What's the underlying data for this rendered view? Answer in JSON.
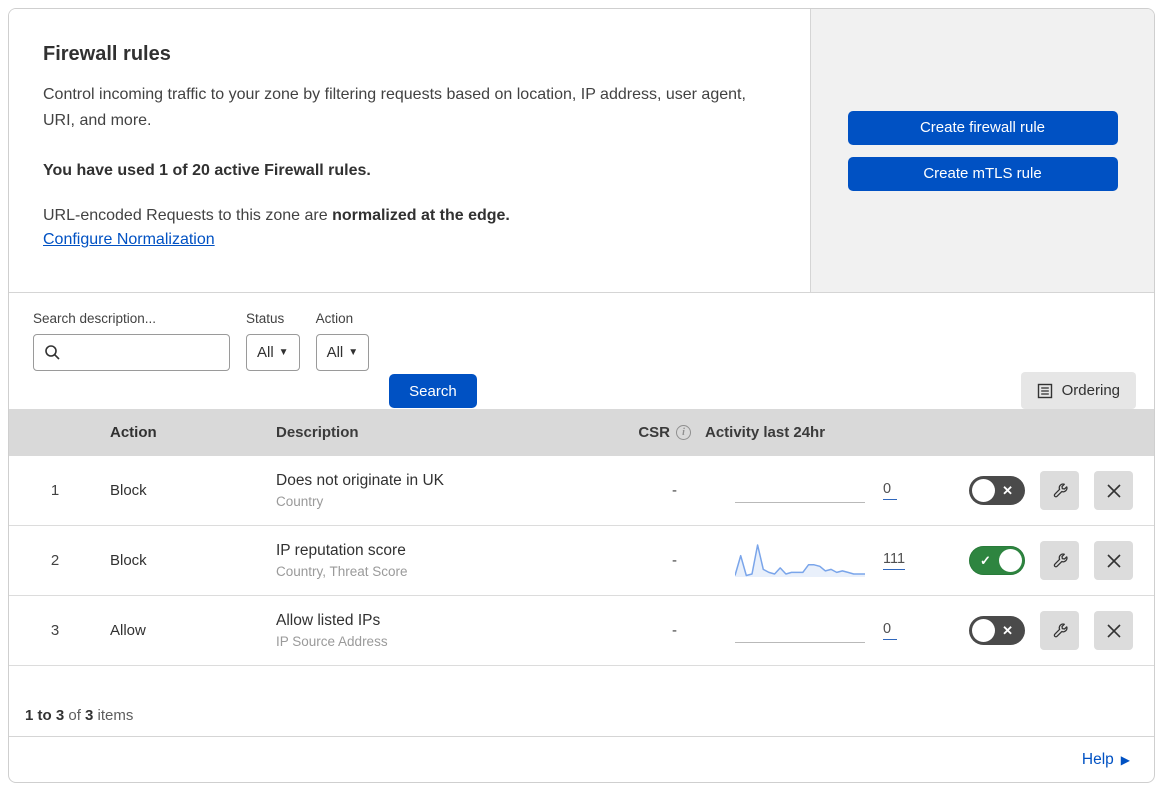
{
  "header": {
    "title": "Firewall rules",
    "description": "Control incoming traffic to your zone by filtering requests based on location, IP address, user agent, URI, and more.",
    "usage_notice": "You have used 1 of 20 active Firewall rules.",
    "normalization_prefix": "URL-encoded Requests to this zone are ",
    "normalization_bold": "normalized at the edge.",
    "normalization_link": "Configure Normalization",
    "create_firewall_rule_label": "Create firewall rule",
    "create_mtls_rule_label": "Create mTLS rule"
  },
  "filters": {
    "search_label": "Search description...",
    "search_value": "",
    "search_icon": "magnifier-icon",
    "status_label": "Status",
    "status_value": "All",
    "action_label": "Action",
    "action_value": "All",
    "search_button_label": "Search",
    "ordering_button_label": "Ordering",
    "ordering_icon": "list-document-icon"
  },
  "table": {
    "columns": {
      "action": "Action",
      "description": "Description",
      "csr": "CSR",
      "activity": "Activity last 24hr"
    },
    "csr_info_icon": "info-icon",
    "rows": [
      {
        "index": "1",
        "action": "Block",
        "description": "Does not originate in UK",
        "fields": "Country",
        "csr": "-",
        "activity_count": "0",
        "enabled": false,
        "has_sparkline": false
      },
      {
        "index": "2",
        "action": "Block",
        "description": "IP reputation score",
        "fields": "Country, Threat Score",
        "csr": "-",
        "activity_count": "111",
        "enabled": true,
        "has_sparkline": true
      },
      {
        "index": "3",
        "action": "Allow",
        "description": "Allow listed IPs",
        "fields": "IP Source Address",
        "csr": "-",
        "activity_count": "0",
        "enabled": false,
        "has_sparkline": false
      }
    ],
    "row_icons": {
      "toggle": "status-toggle",
      "edit": "wrench-icon",
      "delete": "x-icon"
    }
  },
  "chart_data": {
    "type": "area",
    "title": "Activity last 24hr sparkline (rule 2: IP reputation score)",
    "x": [
      0,
      1,
      2,
      3,
      4,
      5,
      6,
      7,
      8,
      9,
      10,
      11,
      12,
      13,
      14,
      15,
      16,
      17,
      18,
      19,
      20,
      21,
      22,
      23
    ],
    "values": [
      1,
      14,
      1,
      2,
      21,
      5,
      3,
      2,
      6,
      2,
      3,
      3,
      3,
      8,
      8,
      7,
      4,
      5,
      3,
      4,
      3,
      2,
      2,
      2
    ],
    "total_label": "111",
    "xlabel": "",
    "ylabel": "",
    "axes_hidden": true,
    "line_color": "#7aa5ea",
    "fill_color": "#e9f0fb"
  },
  "footer": {
    "range_bold": "1 to 3",
    "of_text": " of ",
    "total_bold": "3",
    "items_text": " items",
    "help_label": "Help",
    "help_arrow": "▶"
  },
  "colors": {
    "accent_blue": "#0051c3",
    "toggle_on_green": "#2e8540",
    "toggle_off_gray": "#4a4a4a",
    "table_header_gray": "#d9d9d9",
    "side_panel_gray": "#f1f1f1",
    "border_gray": "#d5d5d5"
  }
}
